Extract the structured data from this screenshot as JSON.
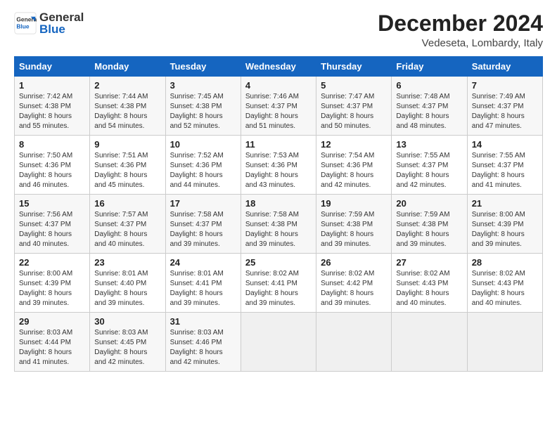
{
  "logo": {
    "general": "General",
    "blue": "Blue"
  },
  "title": {
    "month_year": "December 2024",
    "location": "Vedeseta, Lombardy, Italy"
  },
  "weekdays": [
    "Sunday",
    "Monday",
    "Tuesday",
    "Wednesday",
    "Thursday",
    "Friday",
    "Saturday"
  ],
  "weeks": [
    [
      {
        "day": "1",
        "sunrise": "7:42 AM",
        "sunset": "4:38 PM",
        "daylight": "8 hours and 55 minutes."
      },
      {
        "day": "2",
        "sunrise": "7:44 AM",
        "sunset": "4:38 PM",
        "daylight": "8 hours and 54 minutes."
      },
      {
        "day": "3",
        "sunrise": "7:45 AM",
        "sunset": "4:38 PM",
        "daylight": "8 hours and 52 minutes."
      },
      {
        "day": "4",
        "sunrise": "7:46 AM",
        "sunset": "4:37 PM",
        "daylight": "8 hours and 51 minutes."
      },
      {
        "day": "5",
        "sunrise": "7:47 AM",
        "sunset": "4:37 PM",
        "daylight": "8 hours and 50 minutes."
      },
      {
        "day": "6",
        "sunrise": "7:48 AM",
        "sunset": "4:37 PM",
        "daylight": "8 hours and 48 minutes."
      },
      {
        "day": "7",
        "sunrise": "7:49 AM",
        "sunset": "4:37 PM",
        "daylight": "8 hours and 47 minutes."
      }
    ],
    [
      {
        "day": "8",
        "sunrise": "7:50 AM",
        "sunset": "4:36 PM",
        "daylight": "8 hours and 46 minutes."
      },
      {
        "day": "9",
        "sunrise": "7:51 AM",
        "sunset": "4:36 PM",
        "daylight": "8 hours and 45 minutes."
      },
      {
        "day": "10",
        "sunrise": "7:52 AM",
        "sunset": "4:36 PM",
        "daylight": "8 hours and 44 minutes."
      },
      {
        "day": "11",
        "sunrise": "7:53 AM",
        "sunset": "4:36 PM",
        "daylight": "8 hours and 43 minutes."
      },
      {
        "day": "12",
        "sunrise": "7:54 AM",
        "sunset": "4:36 PM",
        "daylight": "8 hours and 42 minutes."
      },
      {
        "day": "13",
        "sunrise": "7:55 AM",
        "sunset": "4:37 PM",
        "daylight": "8 hours and 42 minutes."
      },
      {
        "day": "14",
        "sunrise": "7:55 AM",
        "sunset": "4:37 PM",
        "daylight": "8 hours and 41 minutes."
      }
    ],
    [
      {
        "day": "15",
        "sunrise": "7:56 AM",
        "sunset": "4:37 PM",
        "daylight": "8 hours and 40 minutes."
      },
      {
        "day": "16",
        "sunrise": "7:57 AM",
        "sunset": "4:37 PM",
        "daylight": "8 hours and 40 minutes."
      },
      {
        "day": "17",
        "sunrise": "7:58 AM",
        "sunset": "4:37 PM",
        "daylight": "8 hours and 39 minutes."
      },
      {
        "day": "18",
        "sunrise": "7:58 AM",
        "sunset": "4:38 PM",
        "daylight": "8 hours and 39 minutes."
      },
      {
        "day": "19",
        "sunrise": "7:59 AM",
        "sunset": "4:38 PM",
        "daylight": "8 hours and 39 minutes."
      },
      {
        "day": "20",
        "sunrise": "7:59 AM",
        "sunset": "4:38 PM",
        "daylight": "8 hours and 39 minutes."
      },
      {
        "day": "21",
        "sunrise": "8:00 AM",
        "sunset": "4:39 PM",
        "daylight": "8 hours and 39 minutes."
      }
    ],
    [
      {
        "day": "22",
        "sunrise": "8:00 AM",
        "sunset": "4:39 PM",
        "daylight": "8 hours and 39 minutes."
      },
      {
        "day": "23",
        "sunrise": "8:01 AM",
        "sunset": "4:40 PM",
        "daylight": "8 hours and 39 minutes."
      },
      {
        "day": "24",
        "sunrise": "8:01 AM",
        "sunset": "4:41 PM",
        "daylight": "8 hours and 39 minutes."
      },
      {
        "day": "25",
        "sunrise": "8:02 AM",
        "sunset": "4:41 PM",
        "daylight": "8 hours and 39 minutes."
      },
      {
        "day": "26",
        "sunrise": "8:02 AM",
        "sunset": "4:42 PM",
        "daylight": "8 hours and 39 minutes."
      },
      {
        "day": "27",
        "sunrise": "8:02 AM",
        "sunset": "4:43 PM",
        "daylight": "8 hours and 40 minutes."
      },
      {
        "day": "28",
        "sunrise": "8:02 AM",
        "sunset": "4:43 PM",
        "daylight": "8 hours and 40 minutes."
      }
    ],
    [
      {
        "day": "29",
        "sunrise": "8:03 AM",
        "sunset": "4:44 PM",
        "daylight": "8 hours and 41 minutes."
      },
      {
        "day": "30",
        "sunrise": "8:03 AM",
        "sunset": "4:45 PM",
        "daylight": "8 hours and 42 minutes."
      },
      {
        "day": "31",
        "sunrise": "8:03 AM",
        "sunset": "4:46 PM",
        "daylight": "8 hours and 42 minutes."
      },
      null,
      null,
      null,
      null
    ]
  ],
  "labels": {
    "sunrise": "Sunrise:",
    "sunset": "Sunset:",
    "daylight": "Daylight:"
  }
}
